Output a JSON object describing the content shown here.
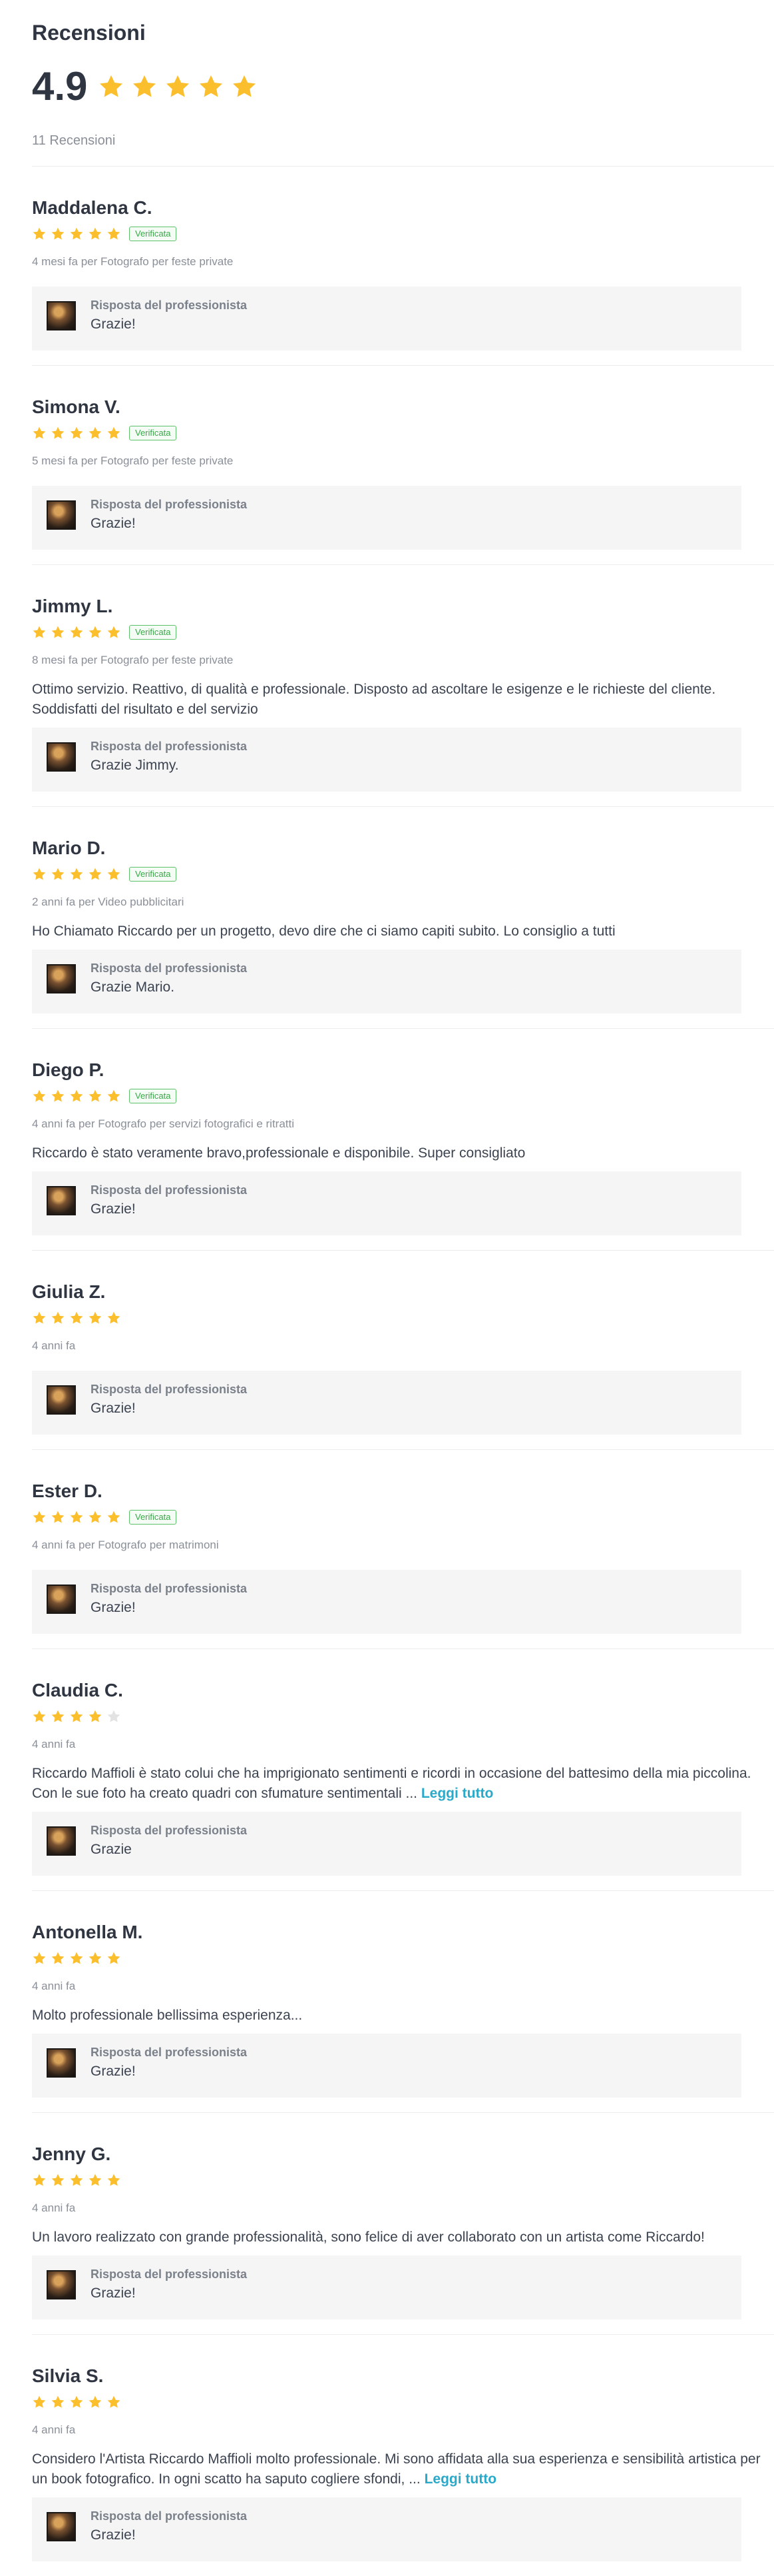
{
  "header": {
    "title": "Recensioni",
    "score": "4.9",
    "count_label": "11 Recensioni"
  },
  "colors": {
    "star_filled": "#fbbf2d",
    "star_empty": "#e3e3e3",
    "badge_green": "#3aa94a",
    "link": "#2aa9c9"
  },
  "reply_label": "Risposta del professionista",
  "reviews": [
    {
      "name": "Maddalena C.",
      "rating": 5,
      "verified": "Verificata",
      "meta": "4 mesi fa per Fotografo per feste private",
      "text": "",
      "read_more": "",
      "reply": "Grazie!"
    },
    {
      "name": "Simona V.",
      "rating": 5,
      "verified": "Verificata",
      "meta": "5 mesi fa per Fotografo per feste private",
      "text": "",
      "read_more": "",
      "reply": "Grazie!"
    },
    {
      "name": "Jimmy L.",
      "rating": 5,
      "verified": "Verificata",
      "meta": "8 mesi fa per Fotografo per feste private",
      "text": "Ottimo servizio. Reattivo, di qualità e professionale. Disposto ad ascoltare le esigenze e le richieste del cliente. Soddisfatti del risultato e del servizio",
      "read_more": "",
      "reply": "Grazie Jimmy."
    },
    {
      "name": "Mario D.",
      "rating": 5,
      "verified": "Verificata",
      "meta": "2 anni fa per Video pubblicitari",
      "text": "Ho Chiamato Riccardo per un progetto, devo dire che ci siamo capiti subito. Lo consiglio a tutti",
      "read_more": "",
      "reply": "Grazie Mario."
    },
    {
      "name": "Diego P.",
      "rating": 5,
      "verified": "Verificata",
      "meta": "4 anni fa per Fotografo per servizi fotografici e ritratti",
      "text": "Riccardo è stato veramente bravo,professionale e disponibile. Super consigliato",
      "read_more": "",
      "reply": "Grazie!"
    },
    {
      "name": "Giulia Z.",
      "rating": 5,
      "verified": "",
      "meta": "4 anni fa",
      "text": "",
      "read_more": "",
      "reply": "Grazie!"
    },
    {
      "name": "Ester D.",
      "rating": 5,
      "verified": "Verificata",
      "meta": "4 anni fa per Fotografo per matrimoni",
      "text": "",
      "read_more": "",
      "reply": "Grazie!"
    },
    {
      "name": "Claudia C.",
      "rating": 4,
      "verified": "",
      "meta": "4 anni fa",
      "text": "Riccardo Maffioli è stato colui che ha imprigionato sentimenti e ricordi in occasione del battesimo della mia piccolina. Con le sue foto ha creato quadri con sfumature sentimentali ...",
      "read_more": "Leggi tutto",
      "reply": "Grazie"
    },
    {
      "name": "Antonella M.",
      "rating": 5,
      "verified": "",
      "meta": "4 anni fa",
      "text": "Molto professionale bellissima esperienza...",
      "read_more": "",
      "reply": "Grazie!"
    },
    {
      "name": "Jenny G.",
      "rating": 5,
      "verified": "",
      "meta": "4 anni fa",
      "text": "Un lavoro realizzato con grande professionalità, sono felice di aver collaborato con un artista come Riccardo!",
      "read_more": "",
      "reply": "Grazie!"
    },
    {
      "name": "Silvia S.",
      "rating": 5,
      "verified": "",
      "meta": "4 anni fa",
      "text": "Considero l'Artista Riccardo Maffioli molto professionale. Mi sono affidata alla sua esperienza e sensibilità artistica per un book fotografico. In ogni scatto ha saputo cogliere sfondi, ...",
      "read_more": "Leggi tutto",
      "reply": "Grazie!"
    }
  ]
}
